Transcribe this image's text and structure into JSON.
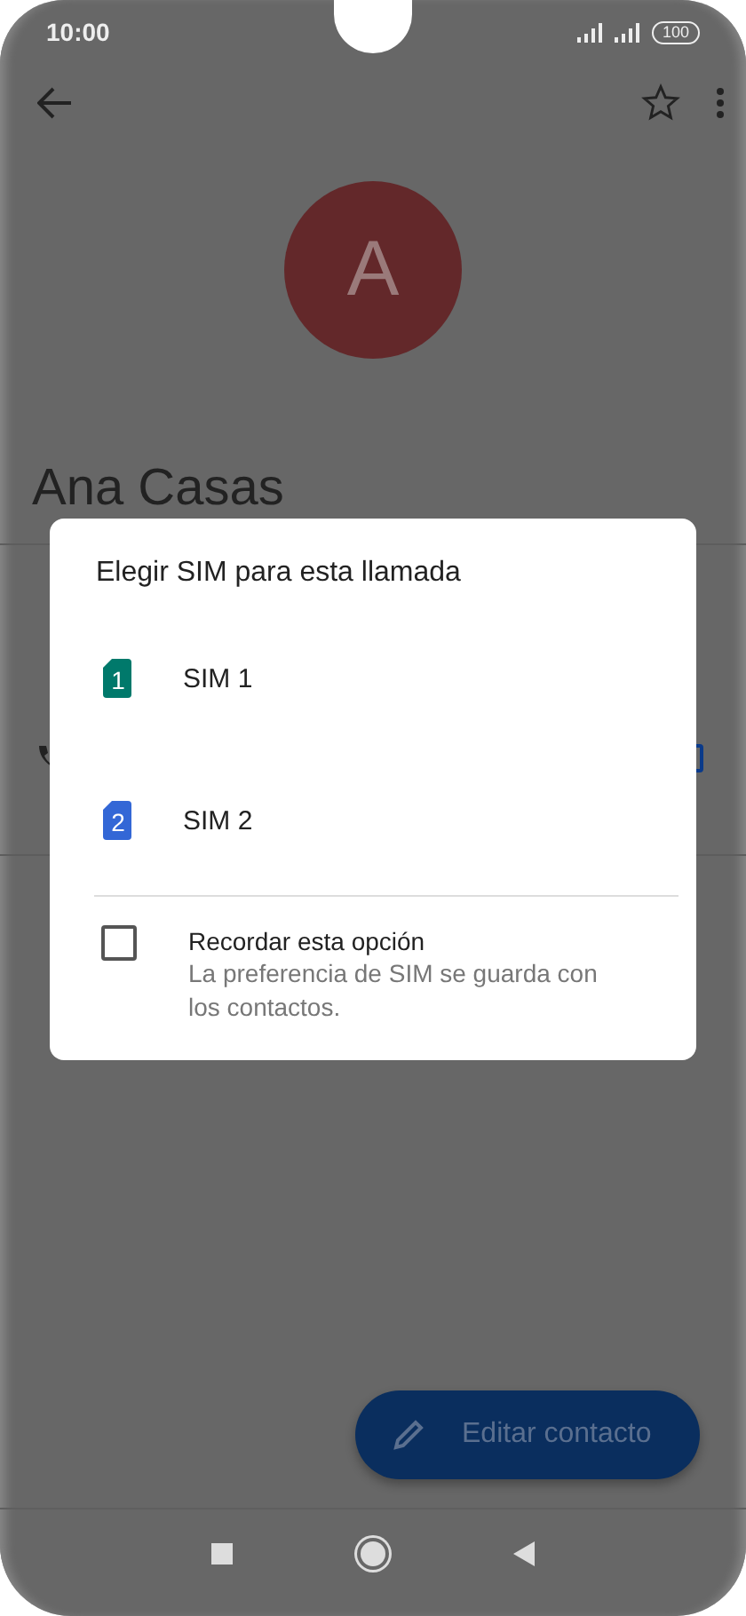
{
  "status_bar": {
    "time": "10:00",
    "battery": "100"
  },
  "contact": {
    "avatar_letter": "A",
    "name": "Ana Casas",
    "starred": false
  },
  "fab": {
    "label": "Editar contacto"
  },
  "dialog": {
    "title": "Elegir SIM para esta llamada",
    "sims": [
      {
        "number": "1",
        "label": "SIM 1",
        "color": "#00796b"
      },
      {
        "number": "2",
        "label": "SIM 2",
        "color": "#3367d6"
      }
    ],
    "remember": {
      "label": "Recordar esta opción",
      "description": "La preferencia de SIM se guarda con los contactos.",
      "checked": false
    }
  }
}
